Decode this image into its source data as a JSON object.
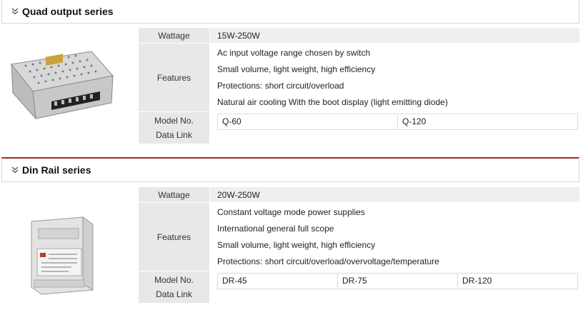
{
  "sections": [
    {
      "title": "Quad output series",
      "wattage_label": "Wattage",
      "wattage": "15W-250W",
      "features_label": "Features",
      "features": [
        "Ac input voltage range chosen by switch",
        "Small volume, light weight, high efficiency",
        "Protections: short circuit/overload",
        "Natural air cooling With the boot display (light emitting diode)"
      ],
      "model_label": "Model No.",
      "datalink_label": "Data Link",
      "models": [
        "Q-60",
        "Q-120"
      ]
    },
    {
      "title": "Din Rail series",
      "wattage_label": "Wattage",
      "wattage": "20W-250W",
      "features_label": "Features",
      "features": [
        "Constant voltage mode power supplies",
        "International general full scope",
        "Small volume, light weight, high efficiency",
        "Protections: short circuit/overload/overvoltage/temperature"
      ],
      "model_label": "Model No.",
      "datalink_label": "Data Link",
      "models": [
        "DR-45",
        "DR-75",
        "DR-120"
      ]
    }
  ],
  "icons": {
    "collapse": "double-chevron-down-icon"
  },
  "colors": {
    "section_divider": "#a52a2a",
    "label_bg": "#e8e8e8"
  }
}
